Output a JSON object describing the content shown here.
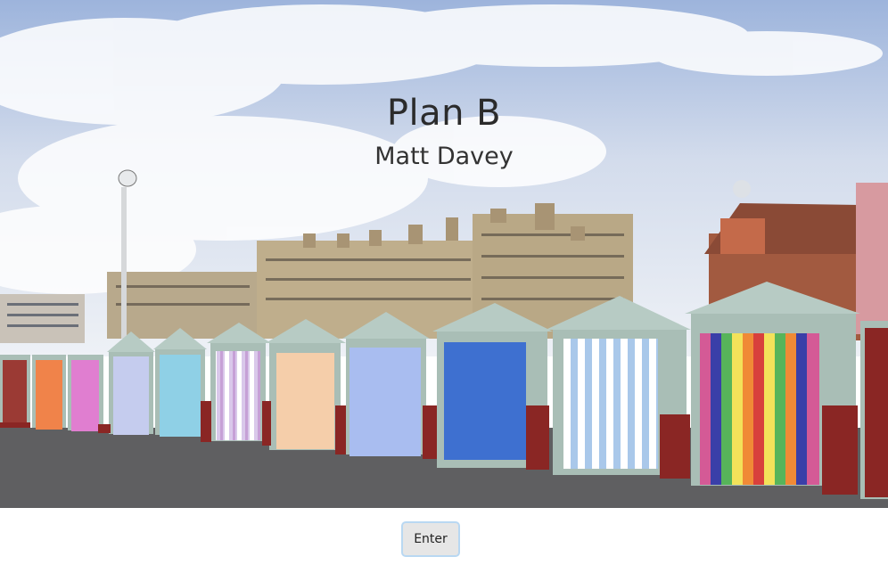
{
  "hero": {
    "title": "Plan B",
    "subtitle": "Matt Davey",
    "image": "beach-huts-photo",
    "colors": {
      "sky_top": "#8fa8d4",
      "sky_bottom": "#e9eef6",
      "pavement": "#5e5e60",
      "hut_roof": "#a9beb6",
      "hut_base": "#8a2624"
    }
  },
  "actions": {
    "enter_label": "Enter"
  }
}
